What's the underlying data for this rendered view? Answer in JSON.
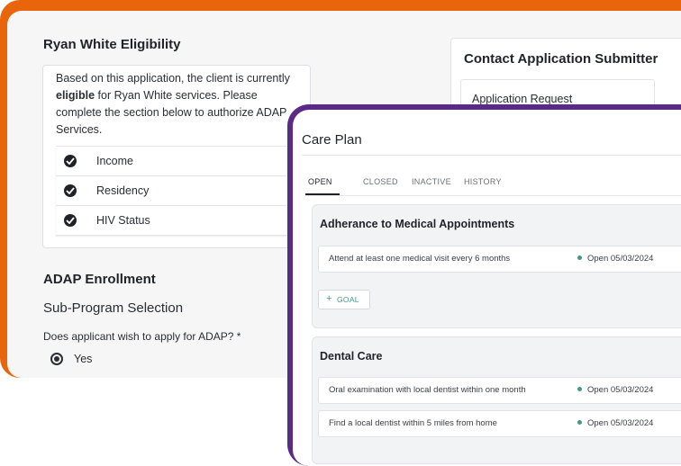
{
  "eligibility": {
    "title": "Ryan White Eligibility",
    "desc_pre": "Based on this application, the client is currently ",
    "desc_bold": "eligible",
    "desc_post": " for Ryan White services. Please complete the section below to authorize ADAP Services.",
    "checks": [
      "Income",
      "Residency",
      "HIV Status"
    ]
  },
  "adap": {
    "title": "ADAP Enrollment",
    "subtitle": "Sub-Program Selection",
    "question": "Does applicant wish to apply for ADAP? *",
    "option_label": "Yes"
  },
  "contact": {
    "title": "Contact Application Submitter",
    "item": "Application Request"
  },
  "care_plan": {
    "title": "Care Plan",
    "tabs": [
      "OPEN",
      "CLOSED",
      "INACTIVE",
      "HISTORY"
    ],
    "sections": [
      {
        "title": "Adherance to Medical Appointments",
        "goals": [
          {
            "text": "Attend at least one medical visit every 6 months",
            "status": "Open 05/03/2024"
          }
        ],
        "button": "GOAL"
      },
      {
        "title": "Dental Care",
        "goals": [
          {
            "text": "Oral examination with local dentist within one month",
            "status": "Open 05/03/2024"
          },
          {
            "text": "Find a local dentist within 5 miles from home",
            "status": "Open 05/03/2024"
          }
        ]
      }
    ]
  },
  "colors": {
    "back_frame": "#e8650c",
    "front_frame": "#5a2a86",
    "status_dot": "#3f9a8a"
  }
}
